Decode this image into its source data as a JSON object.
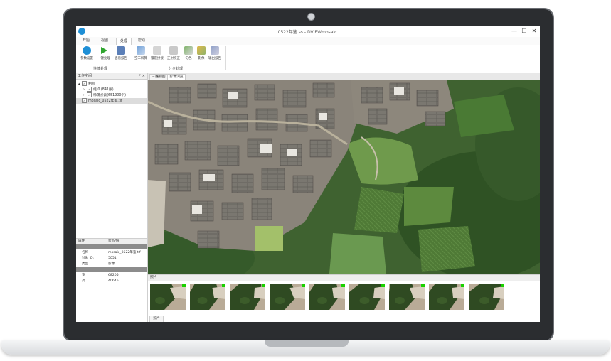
{
  "window": {
    "title": "0522年鉴.ss - DVIEWmosaic",
    "minimize_glyph": "—",
    "maximize_glyph": "☐",
    "close_glyph": "✕"
  },
  "menu": {
    "tabs": [
      "开始",
      "视图",
      "处理",
      "帮助"
    ],
    "active_index": 2
  },
  "ribbon": {
    "quick_group": {
      "label": "快捷处理",
      "buttons": [
        {
          "label": "参数设置",
          "icon": "settings-globe-icon"
        },
        {
          "label": "一键处理",
          "icon": "play-icon"
        },
        {
          "label": "查看报告",
          "icon": "report-icon"
        }
      ]
    },
    "step_group": {
      "label": "分步处理",
      "buttons": [
        {
          "label": "空三解算",
          "icon": "aerial-triangulation-icon"
        },
        {
          "label": "镶嵌拼接",
          "icon": "mosaic-icon"
        },
        {
          "label": "正射校正",
          "icon": "ortho-icon"
        },
        {
          "label": "匀色",
          "icon": "color-balance-icon"
        },
        {
          "label": "影像",
          "icon": "image-stack-icon"
        },
        {
          "label": "输出报告",
          "icon": "export-icon"
        }
      ]
    }
  },
  "workspace": {
    "title": "工作空间",
    "pin_glyph": "ᵖ",
    "close_glyph": "×",
    "tree": [
      {
        "label": "相机",
        "indent": 0,
        "checked": true,
        "expander": "▴"
      },
      {
        "label": "组 0 (841张)",
        "indent": 1,
        "checked": true,
        "expander": "›"
      },
      {
        "label": "稀疏点云(651900个)",
        "indent": 1,
        "checked": true,
        "expander": "›"
      },
      {
        "label": "mosaic_0522年鉴.tif",
        "indent": 0,
        "checked": true,
        "expander": "",
        "selected": true
      }
    ]
  },
  "properties": {
    "header_key": "属性",
    "header_value": "状态/值",
    "rows": [
      {
        "key": "",
        "value": "",
        "section": true
      },
      {
        "key": "名称",
        "value": "mosaic_0522年鉴.tif",
        "section": false
      },
      {
        "key": "对象 ID:",
        "value": "5051",
        "section": false
      },
      {
        "key": "类型",
        "value": "影像",
        "section": false
      },
      {
        "key": "",
        "value": "",
        "section": true
      },
      {
        "key": "宽",
        "value": "68205",
        "section": false
      },
      {
        "key": "高",
        "value": "40645",
        "section": false
      }
    ]
  },
  "doc_tabs": [
    "三维视图",
    "影像浏览"
  ],
  "doc_active_index": 1,
  "photo_panel": {
    "title": "照片",
    "footer_tab": "照片",
    "thumbnail_count": 9
  },
  "colors": {
    "accent": "#1e8fd6",
    "play_green": "#2fa52f",
    "thumb_flag": "#19d100"
  }
}
